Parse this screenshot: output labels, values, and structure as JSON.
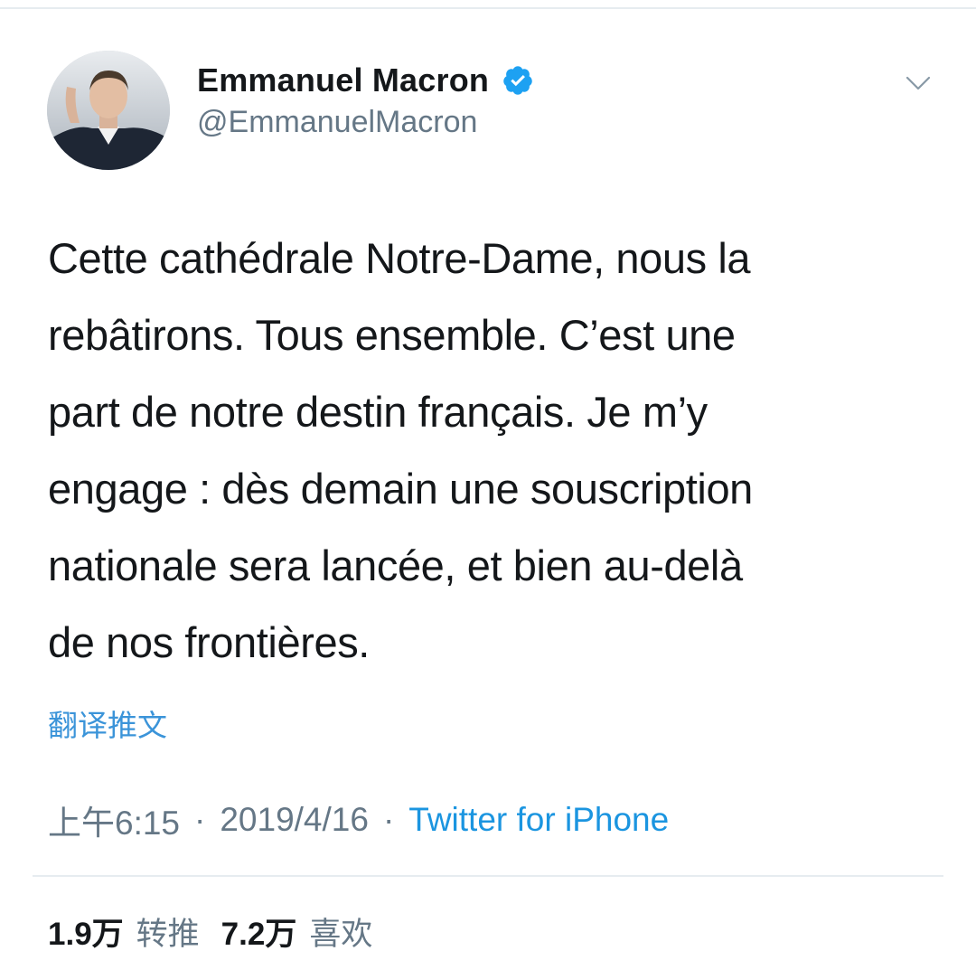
{
  "user": {
    "display_name": "Emmanuel Macron",
    "handle": "@EmmanuelMacron",
    "verified": true
  },
  "icons": {
    "verified": "verified-badge-icon",
    "caret": "chevron-down-icon",
    "avatar": "profile-photo"
  },
  "tweet": {
    "lines": [
      "Cette cathédrale Notre-Dame, nous la",
      "rebâtirons. Tous ensemble. C’est une",
      "part de notre destin français. Je m’y",
      "engage : dès demain une souscription",
      "nationale sera lancée, et bien au-delà",
      "de nos frontières."
    ],
    "translate_label": "翻译推文"
  },
  "meta": {
    "time": "上午6:15",
    "separator": "·",
    "date": "2019/4/16",
    "source": "Twitter for iPhone"
  },
  "stats": {
    "retweets_count": "1.9万",
    "retweets_label": "转推",
    "likes_count": "7.2万",
    "likes_label": "喜欢"
  },
  "colors": {
    "link": "#1b95e0",
    "secondary_text": "#657786",
    "primary_text": "#14171a",
    "verified_badge": "#1da1f2",
    "divider": "#e6ecf0"
  }
}
